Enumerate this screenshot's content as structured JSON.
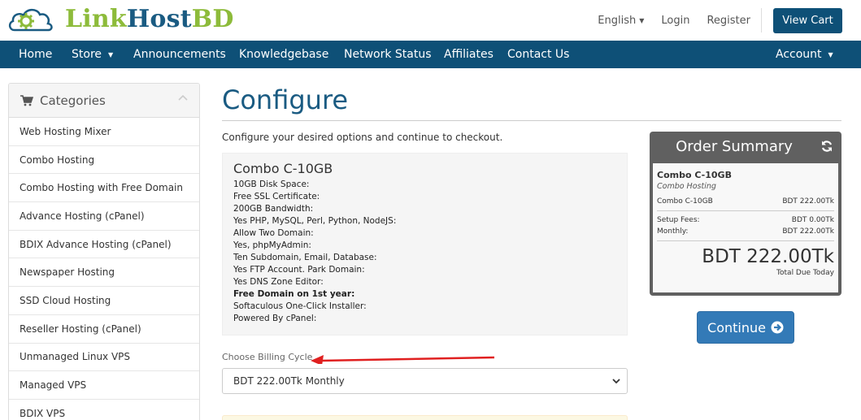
{
  "brand": {
    "logo_part1": "Link",
    "logo_part2": "Host",
    "logo_part3": "BD"
  },
  "top_links": {
    "language": "English",
    "login": "Login",
    "register": "Register",
    "view_cart": "View Cart"
  },
  "nav": {
    "home": "Home",
    "store": "Store",
    "announcements": "Announcements",
    "knowledgebase": "Knowledgebase",
    "network_status": "Network Status",
    "affiliates": "Affiliates",
    "contact_us": "Contact Us",
    "account": "Account"
  },
  "sidebar": {
    "title": "Categories",
    "items": [
      "Web Hosting Mixer",
      "Combo Hosting",
      "Combo Hosting with Free Domain",
      "Advance Hosting (cPanel)",
      "BDIX Advance Hosting (cPanel)",
      "Newspaper Hosting",
      "SSD Cloud Hosting",
      "Reseller Hosting (cPanel)",
      "Unmanaged Linux VPS",
      "Managed VPS",
      "BDIX VPS"
    ]
  },
  "main": {
    "title": "Configure",
    "intro": "Configure your desired options and continue to checkout.",
    "product": {
      "name": "Combo C-10GB",
      "features": [
        "10GB Disk Space:",
        "Free SSL Certificate:",
        "200GB Bandwidth:",
        "Yes PHP, MySQL, Perl, Python, NodeJS:",
        "Allow Two Domain:",
        "Yes, phpMyAdmin:",
        "Ten Subdomain, Email, Database:",
        "Yes FTP Account. Park Domain:",
        "Yes DNS Zone Editor:",
        "Free Domain on 1st year:",
        "Softaculous One-Click Installer:",
        "Powered By cPanel:"
      ]
    },
    "billing": {
      "label": "Choose Billing Cycle",
      "selected": "BDT 222.00Tk Monthly"
    }
  },
  "summary": {
    "title": "Order Summary",
    "product_name": "Combo C-10GB",
    "product_group": "Combo Hosting",
    "line_label": "Combo C-10GB",
    "line_value": "BDT 222.00Tk",
    "setup_label": "Setup Fees:",
    "setup_value": "BDT 0.00Tk",
    "monthly_label": "Monthly:",
    "monthly_value": "BDT 222.00Tk",
    "total": "BDT 222.00Tk",
    "total_label": "Total Due Today",
    "continue": "Continue"
  },
  "colors": {
    "brand_green": "#8dbb3a",
    "navy": "#0e5077",
    "primary_button": "#337ab7",
    "annotation_arrow": "#e02020"
  }
}
